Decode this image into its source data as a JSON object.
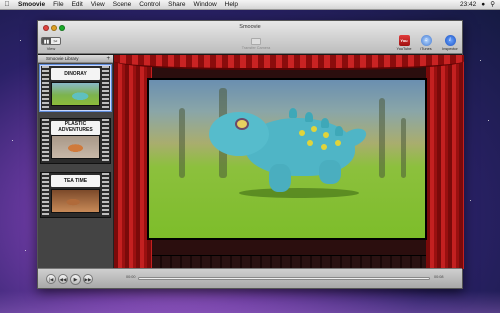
{
  "menubar": {
    "apple": "",
    "items": [
      "Smoovie",
      "File",
      "Edit",
      "View",
      "Scene",
      "Control",
      "Share",
      "Window",
      "Help"
    ],
    "clock": "23:42"
  },
  "window": {
    "title": "Smoovie",
    "toolbar": {
      "view_on": "▮▮",
      "view_off": "✂",
      "view_label": "View",
      "transfer_label": "Transfer Camera",
      "youtube_icon": "You",
      "youtube_label": "YouTube",
      "itunes_icon": "♫",
      "itunes_label": "iTunes",
      "inspector_icon": "i",
      "inspector_label": "Inspector"
    }
  },
  "library": {
    "header": "Smoovie Library",
    "add": "+",
    "clips": [
      {
        "title": "DINORAY"
      },
      {
        "title_line1": "PLASTIC",
        "title_line2": "ADVENTURES"
      },
      {
        "title": "TEA TIME"
      }
    ]
  },
  "player": {
    "start": "|◀",
    "rewind": "◀◀",
    "play": "▶",
    "forward": "▶▶",
    "time_elapsed": "00:00",
    "time_total": "00:08"
  },
  "colors": {
    "curtain": "#b51818",
    "selection": "#5d8ad8",
    "screen_grass": "#7dbd2a",
    "dino": "#4fb5c6"
  }
}
